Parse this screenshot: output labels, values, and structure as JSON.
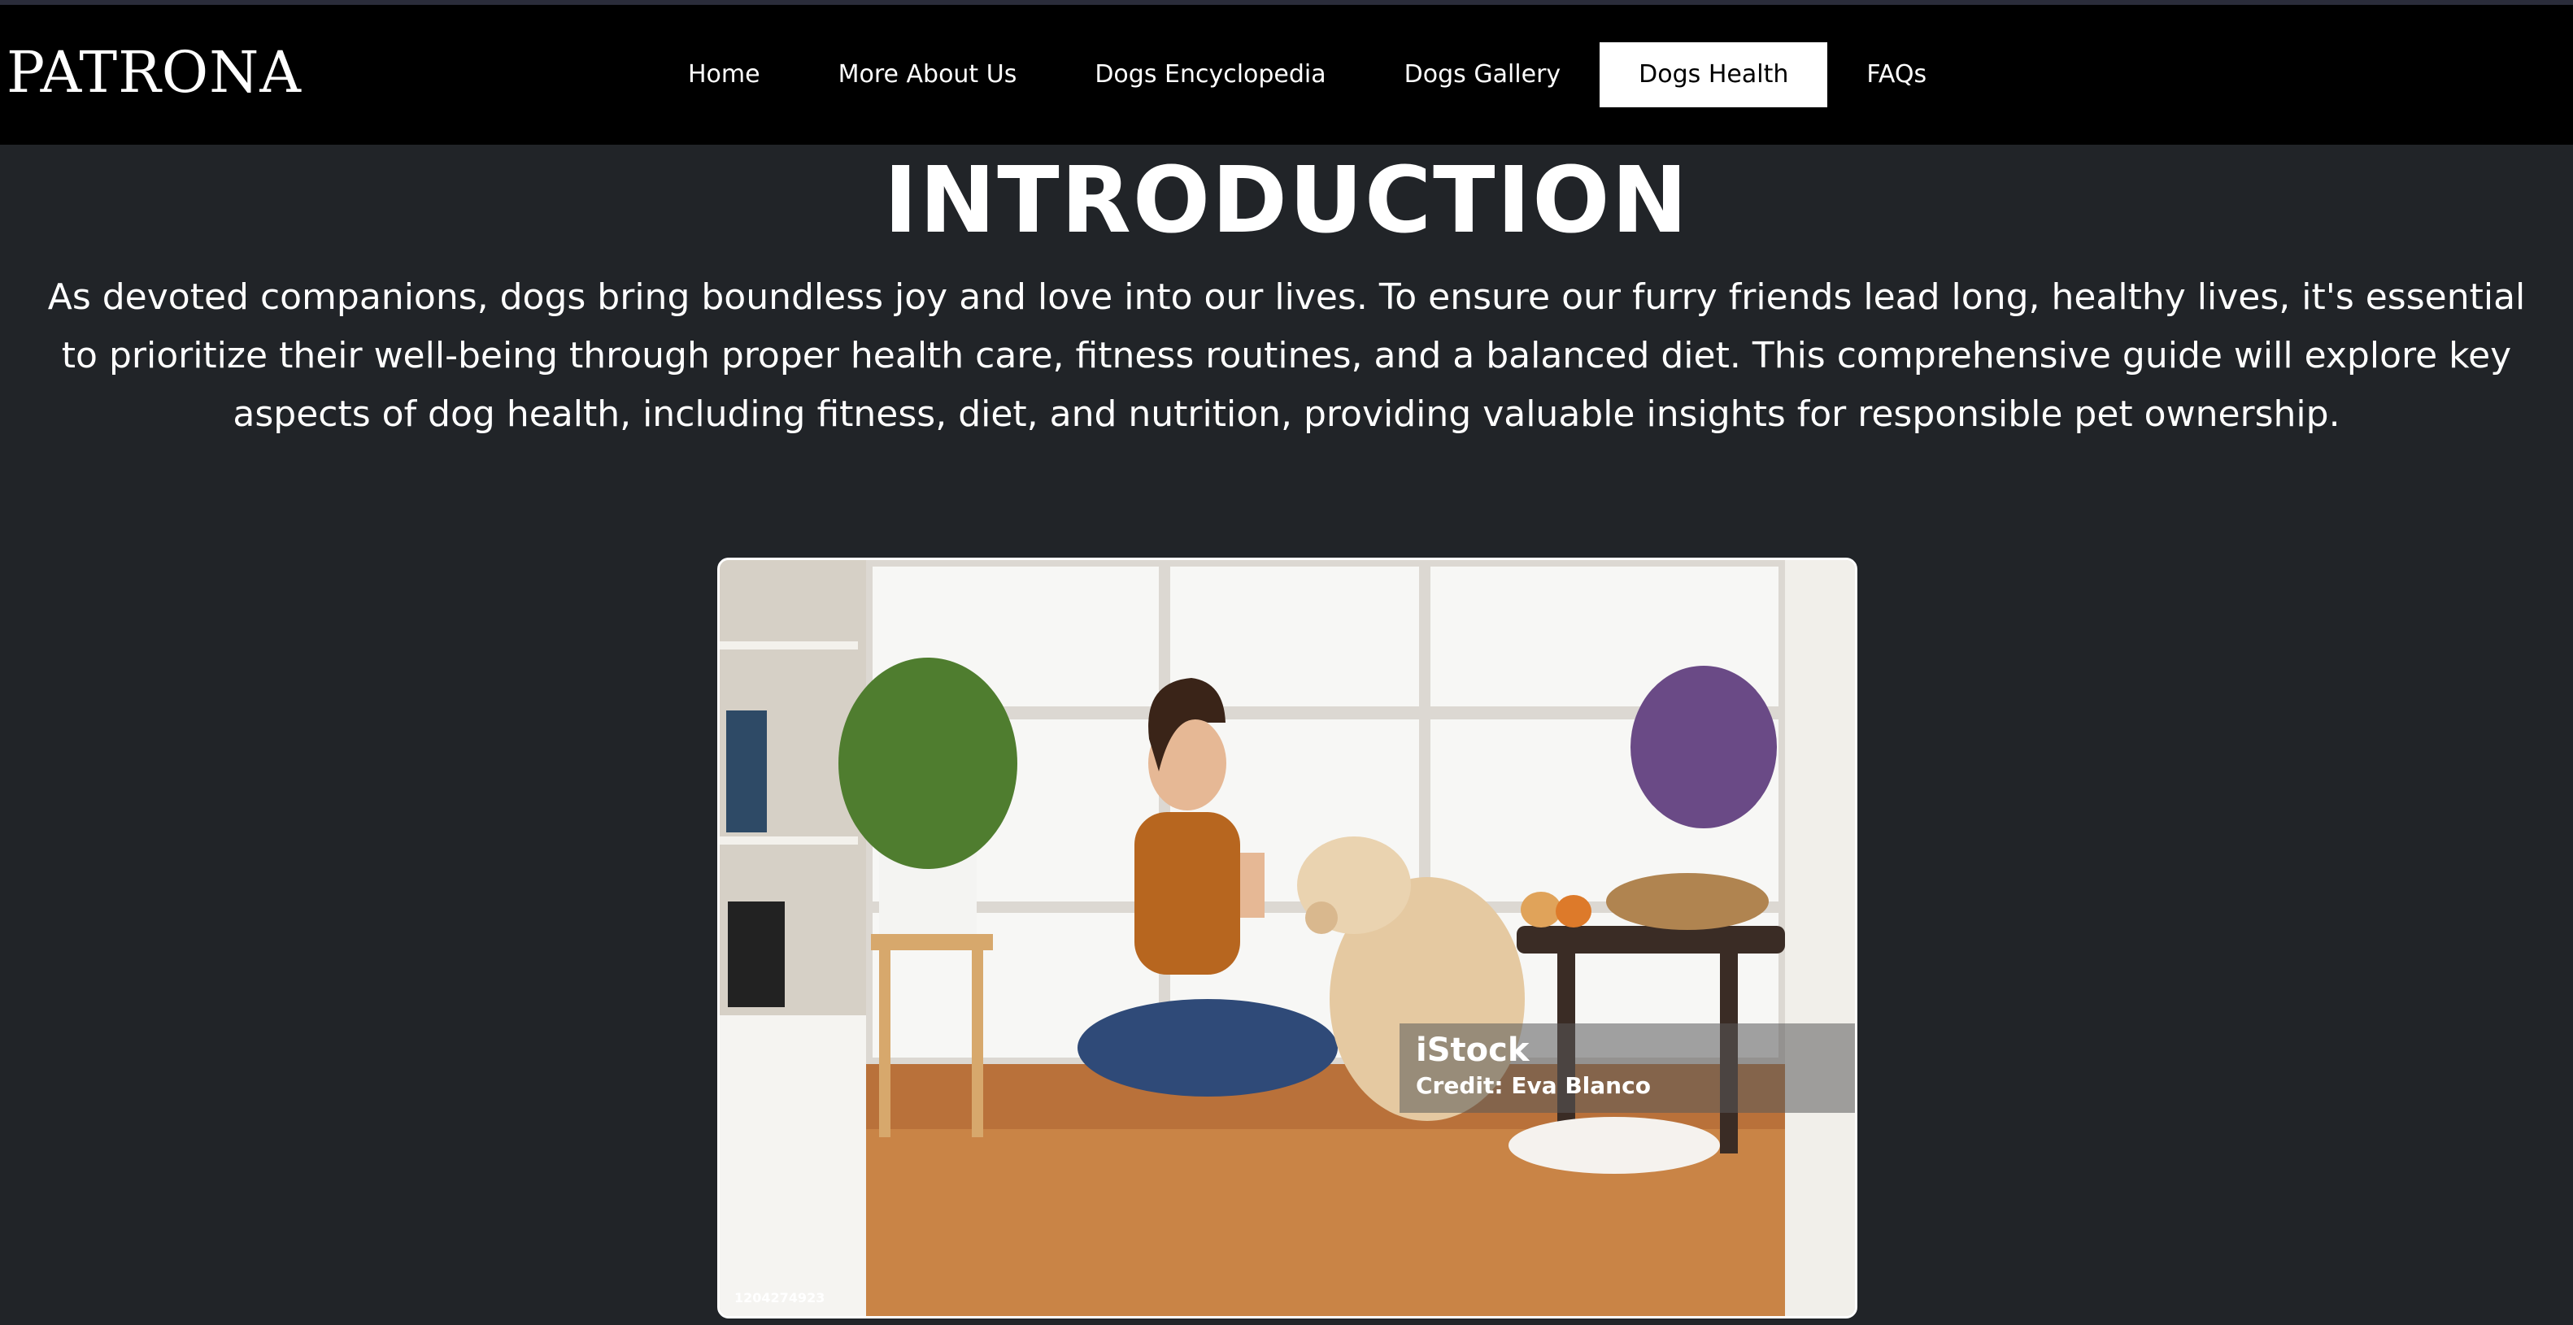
{
  "brand": {
    "logo": "PATRONA"
  },
  "nav": {
    "items": [
      {
        "label": "Home"
      },
      {
        "label": "More About Us"
      },
      {
        "label": "Dogs Encyclopedia"
      },
      {
        "label": "Dogs Gallery"
      },
      {
        "label": "Dogs Health",
        "active": true
      },
      {
        "label": "FAQs"
      }
    ]
  },
  "main": {
    "title": "INTRODUCTION",
    "intro": "As devoted companions, dogs bring boundless joy and love into our lives. To ensure our furry friends lead long, healthy lives, it's essential to prioritize their well-being through proper health care, fitness routines, and a balanced diet. This comprehensive guide will explore key aspects of dog health, including fitness, diet, and nutrition, providing valuable insights for responsible pet ownership."
  },
  "photo": {
    "watermark_brand": "iStock",
    "credit": "Credit: Eva Blanco",
    "stock_id": "1204274923"
  }
}
